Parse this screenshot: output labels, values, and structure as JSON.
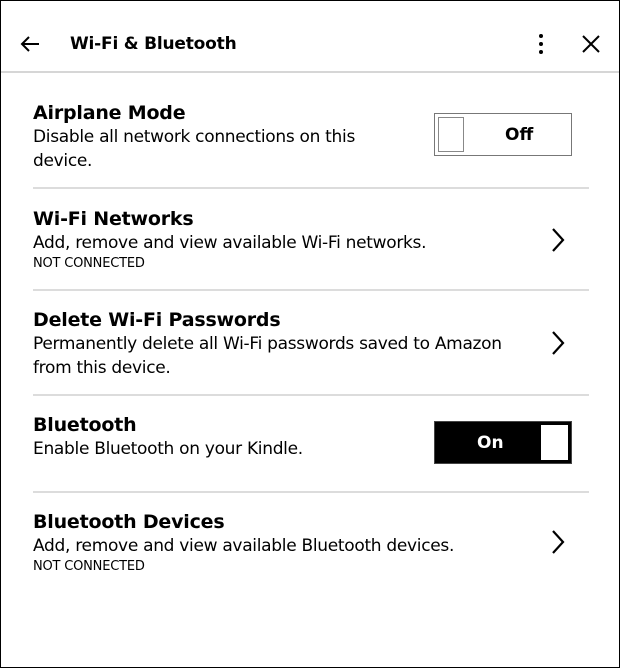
{
  "header": {
    "title": "Wi-Fi & Bluetooth",
    "back_icon": "arrow-left-icon",
    "more_icon": "vertical-dots-icon",
    "close_icon": "close-x-icon"
  },
  "settings": [
    {
      "title": "Airplane Mode",
      "description_lines": [
        "Disable all network connections on this",
        "device."
      ],
      "control": "toggle",
      "toggle_state": "Off"
    },
    {
      "title": "Wi-Fi Networks",
      "description_lines": [
        "Add, remove and view available Wi-Fi networks."
      ],
      "status": "NOT CONNECTED",
      "control": "chevron"
    },
    {
      "title": "Delete Wi-Fi Passwords",
      "description_lines": [
        "Permanently delete all Wi-Fi passwords saved to Amazon",
        "from this device."
      ],
      "control": "chevron"
    },
    {
      "title": "Bluetooth",
      "description_lines": [
        "Enable Bluetooth on your Kindle."
      ],
      "control": "toggle",
      "toggle_state": "On"
    },
    {
      "title": "Bluetooth Devices",
      "description_lines": [
        "Add, remove and view available Bluetooth devices."
      ],
      "status": "NOT CONNECTED",
      "control": "chevron"
    }
  ]
}
